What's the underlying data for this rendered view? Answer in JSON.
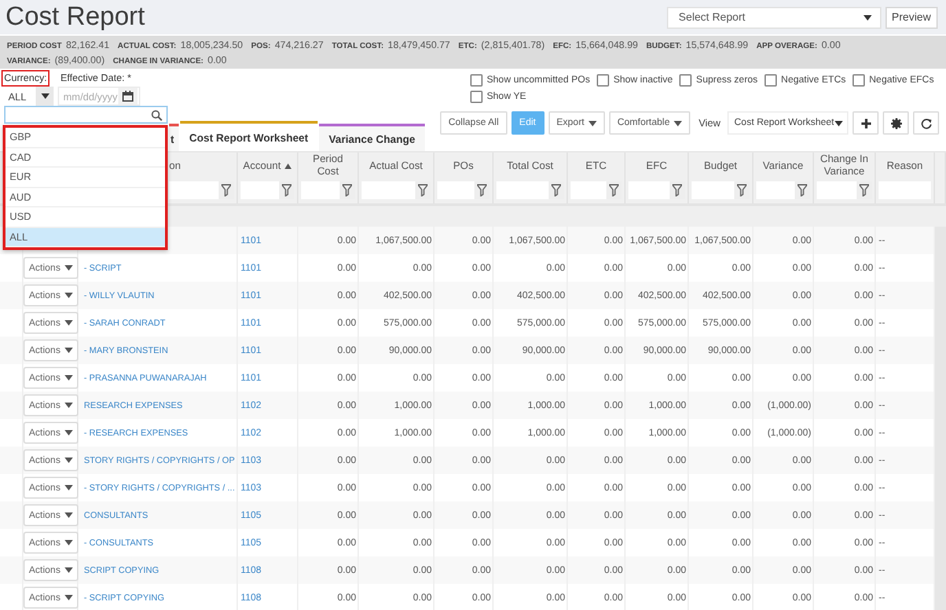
{
  "title": "Cost Report",
  "report_select": {
    "placeholder": "Select Report"
  },
  "preview_button": "Preview",
  "summary": [
    {
      "label": "PERIOD COST",
      "value": "82,162.41"
    },
    {
      "label": "ACTUAL COST:",
      "value": "18,005,234.50"
    },
    {
      "label": "POS:",
      "value": "474,216.27"
    },
    {
      "label": "TOTAL COST:",
      "value": "18,479,450.77"
    },
    {
      "label": "ETC:",
      "value": "(2,815,401.78)"
    },
    {
      "label": "EFC:",
      "value": "15,664,048.99"
    },
    {
      "label": "BUDGET:",
      "value": "15,574,648.99"
    },
    {
      "label": "APP OVERAGE:",
      "value": "0.00"
    },
    {
      "label": "VARIANCE:",
      "value": "(89,400.00)"
    },
    {
      "label": "CHANGE IN VARIANCE:",
      "value": "0.00"
    }
  ],
  "filters": {
    "currency": {
      "label": "Currency:",
      "highlighted": true,
      "value": "ALL"
    },
    "effective_date": {
      "label": "Effective Date: *",
      "placeholder": "mm/dd/yyyy"
    }
  },
  "options": [
    {
      "label": "Show uncommitted POs",
      "checked": false
    },
    {
      "label": "Show inactive",
      "checked": false
    },
    {
      "label": "Supress zeros",
      "checked": false
    },
    {
      "label": "Negative ETCs",
      "checked": false
    },
    {
      "label": "Negative EFCs",
      "checked": false
    },
    {
      "label": "Show YE",
      "checked": false
    }
  ],
  "currency_dropdown": {
    "highlighted": true,
    "items": [
      {
        "label": "GBP",
        "selected": false
      },
      {
        "label": "CAD",
        "selected": false
      },
      {
        "label": "EUR",
        "selected": false
      },
      {
        "label": "AUD",
        "selected": false
      },
      {
        "label": "USD",
        "selected": false
      },
      {
        "label": "ALL",
        "selected": true
      }
    ]
  },
  "tabs": [
    {
      "label": "t",
      "selected": false,
      "color": "#e8534f"
    },
    {
      "label": "Cost Report Worksheet",
      "selected": true,
      "color": "#d6a21b"
    },
    {
      "label": "Variance Change",
      "selected": false,
      "color": "#b36bd0"
    }
  ],
  "toolbar": {
    "buttons": [
      {
        "label": "Collapse All",
        "kind": "plain"
      },
      {
        "label": "Edit",
        "kind": "primary"
      },
      {
        "label": "Export",
        "kind": "menu"
      },
      {
        "label": "Comfortable",
        "kind": "menu"
      }
    ],
    "view_label": "View",
    "view_select": "Cost Report Worksheet"
  },
  "table": {
    "columns": [
      {
        "label": "on",
        "sorted": false,
        "filter_icon": true
      },
      {
        "label": "Account",
        "sorted": true,
        "filter_icon": true
      },
      {
        "label": "Period Cost",
        "sorted": false,
        "filter_icon": true
      },
      {
        "label": "Actual Cost",
        "sorted": false,
        "filter_icon": true
      },
      {
        "label": "POs",
        "sorted": false,
        "filter_icon": true
      },
      {
        "label": "Total Cost",
        "sorted": false,
        "filter_icon": true
      },
      {
        "label": "ETC",
        "sorted": false,
        "filter_icon": true
      },
      {
        "label": "EFC",
        "sorted": false,
        "filter_icon": true
      },
      {
        "label": "Budget",
        "sorted": false,
        "filter_icon": true
      },
      {
        "label": "Variance",
        "sorted": false,
        "filter_icon": true
      },
      {
        "label": "Change In Variance",
        "sorted": false,
        "filter_icon": true
      },
      {
        "label": "Reason",
        "sorted": false,
        "filter_icon": false
      }
    ],
    "rows": [
      {
        "account": "1101",
        "values": [
          "0.00",
          "1,067,500.00",
          "0.00",
          "1,067,500.00",
          "0.00",
          "1,067,500.00",
          "1,067,500.00",
          "0.00",
          "0.00"
        ],
        "reason": "--"
      },
      {
        "actions": "Actions",
        "description": "- SCRIPT",
        "account": "1101",
        "values": [
          "0.00",
          "0.00",
          "0.00",
          "0.00",
          "0.00",
          "0.00",
          "0.00",
          "0.00",
          "0.00"
        ],
        "reason": "--"
      },
      {
        "actions": "Actions",
        "description": "- WILLY VLAUTIN",
        "account": "1101",
        "values": [
          "0.00",
          "402,500.00",
          "0.00",
          "402,500.00",
          "0.00",
          "402,500.00",
          "402,500.00",
          "0.00",
          "0.00"
        ],
        "reason": "--"
      },
      {
        "actions": "Actions",
        "description": "- SARAH CONRADT",
        "account": "1101",
        "values": [
          "0.00",
          "575,000.00",
          "0.00",
          "575,000.00",
          "0.00",
          "575,000.00",
          "575,000.00",
          "0.00",
          "0.00"
        ],
        "reason": "--"
      },
      {
        "actions": "Actions",
        "description": "- MARY BRONSTEIN",
        "account": "1101",
        "values": [
          "0.00",
          "90,000.00",
          "0.00",
          "90,000.00",
          "0.00",
          "90,000.00",
          "90,000.00",
          "0.00",
          "0.00"
        ],
        "reason": "--"
      },
      {
        "actions": "Actions",
        "description": "- PRASANNA PUWANARAJAH",
        "account": "1101",
        "values": [
          "0.00",
          "0.00",
          "0.00",
          "0.00",
          "0.00",
          "0.00",
          "0.00",
          "0.00",
          "0.00"
        ],
        "reason": "--"
      },
      {
        "actions": "Actions",
        "description": "RESEARCH EXPENSES",
        "account": "1102",
        "values": [
          "0.00",
          "1,000.00",
          "0.00",
          "1,000.00",
          "0.00",
          "1,000.00",
          "0.00",
          "(1,000.00)",
          "0.00"
        ],
        "reason": "--"
      },
      {
        "actions": "Actions",
        "description": "- RESEARCH EXPENSES",
        "account": "1102",
        "values": [
          "0.00",
          "1,000.00",
          "0.00",
          "1,000.00",
          "0.00",
          "1,000.00",
          "0.00",
          "(1,000.00)",
          "0.00"
        ],
        "reason": "--"
      },
      {
        "actions": "Actions",
        "description": "STORY RIGHTS / COPYRIGHTS / OP",
        "account": "1103",
        "values": [
          "0.00",
          "0.00",
          "0.00",
          "0.00",
          "0.00",
          "0.00",
          "0.00",
          "0.00",
          "0.00"
        ],
        "reason": "--"
      },
      {
        "actions": "Actions",
        "description": "- STORY RIGHTS / COPYRIGHTS / ...",
        "account": "1103",
        "values": [
          "0.00",
          "0.00",
          "0.00",
          "0.00",
          "0.00",
          "0.00",
          "0.00",
          "0.00",
          "0.00"
        ],
        "reason": "--"
      },
      {
        "actions": "Actions",
        "description": "CONSULTANTS",
        "account": "1105",
        "values": [
          "0.00",
          "0.00",
          "0.00",
          "0.00",
          "0.00",
          "0.00",
          "0.00",
          "0.00",
          "0.00"
        ],
        "reason": "--"
      },
      {
        "actions": "Actions",
        "description": "- CONSULTANTS",
        "account": "1105",
        "values": [
          "0.00",
          "0.00",
          "0.00",
          "0.00",
          "0.00",
          "0.00",
          "0.00",
          "0.00",
          "0.00"
        ],
        "reason": "--"
      },
      {
        "actions": "Actions",
        "description": "SCRIPT COPYING",
        "account": "1108",
        "values": [
          "0.00",
          "0.00",
          "0.00",
          "0.00",
          "0.00",
          "0.00",
          "0.00",
          "0.00",
          "0.00"
        ],
        "reason": "--"
      },
      {
        "actions": "Actions",
        "description": "- SCRIPT COPYING",
        "account": "1108",
        "values": [
          "0.00",
          "0.00",
          "0.00",
          "0.00",
          "0.00",
          "0.00",
          "0.00",
          "0.00",
          "0.00"
        ],
        "reason": "--"
      }
    ]
  }
}
